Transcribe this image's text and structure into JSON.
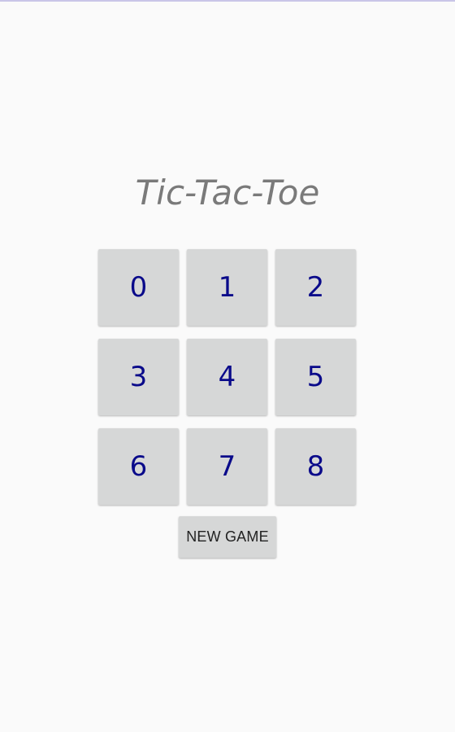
{
  "app": {
    "title": "Tic-Tac-Toe"
  },
  "board": {
    "cells": [
      "0",
      "1",
      "2",
      "3",
      "4",
      "5",
      "6",
      "7",
      "8"
    ]
  },
  "controls": {
    "new_game_label": "NEW GAME"
  },
  "colors": {
    "background": "#fafafa",
    "cell_bg": "#d6d7d7",
    "cell_text": "#0a0a8a",
    "title_text": "#7a7a7a",
    "button_text": "#222222"
  }
}
